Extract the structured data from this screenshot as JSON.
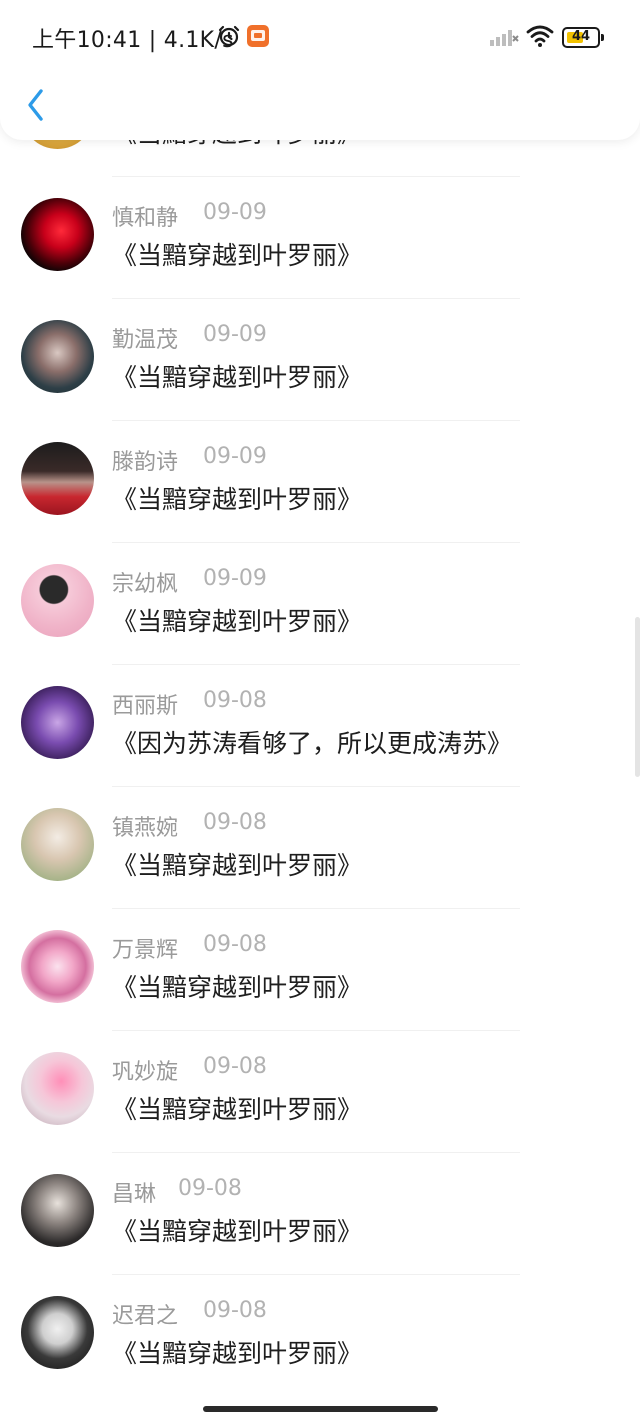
{
  "status_bar": {
    "time": "上午10:41 | 4.1K/s",
    "battery_level": "44",
    "icons": [
      "alarm-icon",
      "app-badge-icon",
      "signal-icon",
      "wifi-icon",
      "battery-icon"
    ]
  },
  "header": {
    "back_icon": "chevron-left-icon"
  },
  "colors": {
    "accent": "#2d9be8",
    "name_gray": "#9a9a9a",
    "date_gray": "#b2b2b2",
    "text": "#1e1e1e"
  },
  "messages": [
    {
      "name": "",
      "date": "",
      "message": "《当黯穿越到叶罗丽》"
    },
    {
      "name": "慎和静",
      "date": "09-09",
      "message": "《当黯穿越到叶罗丽》"
    },
    {
      "name": "勤温茂",
      "date": "09-09",
      "message": "《当黯穿越到叶罗丽》"
    },
    {
      "name": "滕韵诗",
      "date": "09-09",
      "message": "《当黯穿越到叶罗丽》"
    },
    {
      "name": "宗幼枫",
      "date": "09-09",
      "message": "《当黯穿越到叶罗丽》"
    },
    {
      "name": "西丽斯",
      "date": "09-08",
      "message": "《因为苏涛看够了，所以更成涛苏》"
    },
    {
      "name": "镇燕婉",
      "date": "09-08",
      "message": "《当黯穿越到叶罗丽》"
    },
    {
      "name": "万景辉",
      "date": "09-08",
      "message": "《当黯穿越到叶罗丽》"
    },
    {
      "name": "巩妙旋",
      "date": "09-08",
      "message": "《当黯穿越到叶罗丽》"
    },
    {
      "name": "昌琳",
      "date": "09-08",
      "message": "《当黯穿越到叶罗丽》"
    },
    {
      "name": "迟君之",
      "date": "09-08",
      "message": "《当黯穿越到叶罗丽》"
    }
  ]
}
